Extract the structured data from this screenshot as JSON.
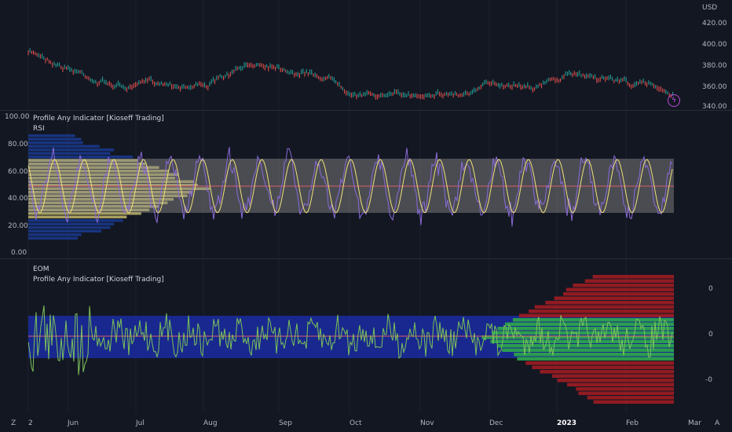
{
  "price_pane": {
    "currency": "USD",
    "ticks": [
      "420.00",
      "400.00",
      "380.00",
      "360.00",
      "340.00"
    ],
    "alert_icon": "lightning-icon"
  },
  "rsi_pane": {
    "title": "Profile Any Indicator [Kioseff Trading]",
    "subtitle": "RSI",
    "ticks": [
      "100.00",
      "80.00",
      "60.00",
      "40.00",
      "20.00",
      "0.00"
    ]
  },
  "eom_pane": {
    "title": "EOM",
    "subtitle": "Profile Any Indicator [Kioseff Trading]",
    "ticks": [
      "0",
      "0",
      "-0"
    ]
  },
  "time_axis": {
    "labels": [
      "2",
      "Jun",
      "Jul",
      "Aug",
      "Sep",
      "Oct",
      "Nov",
      "Dec",
      "2023",
      "Feb",
      "Mar"
    ]
  },
  "corner_buttons": {
    "left": "Z",
    "right": "A"
  },
  "colors": {
    "background": "#131722",
    "rsi_line": "#8a6bd8",
    "rsi_signal": "#f2e27a",
    "eom_line": "#7cc35a",
    "midline": "#e05c6b",
    "band_gray": "#8f8f8f",
    "profile_yellow": "#c2b66a",
    "profile_blue": "#1a3a8f",
    "eom_band_blue": "#1b2a9a",
    "eom_profile_green": "#2ea84a",
    "eom_profile_red": "#a01c22"
  }
}
